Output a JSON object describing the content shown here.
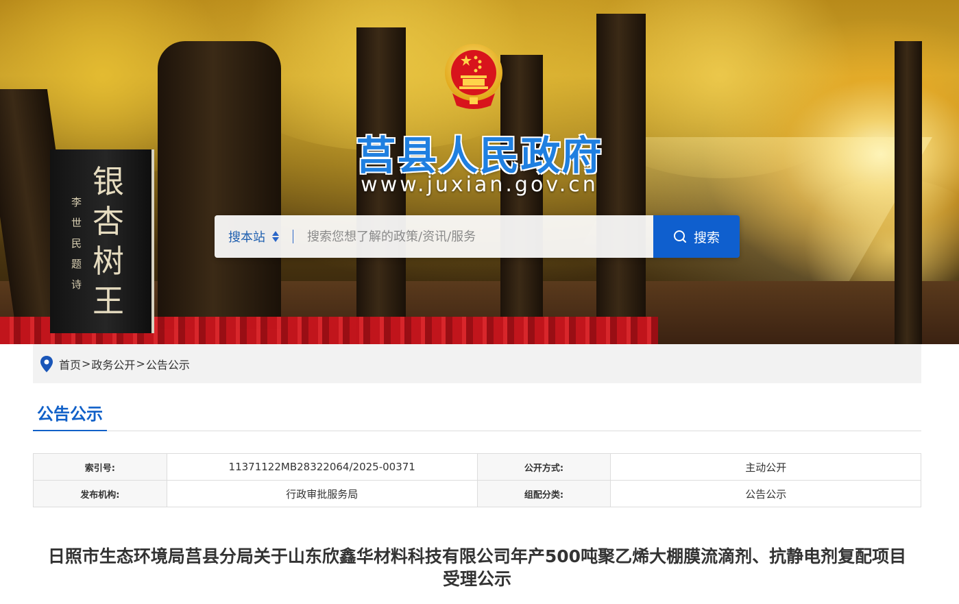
{
  "banner": {
    "site_title": "莒县人民政府",
    "site_url": "www.juxian.gov.cn",
    "stele_text": "银杏树王",
    "stele_small": "李世民题诗"
  },
  "search": {
    "scope_label": "搜本站",
    "placeholder": "搜索您想了解的政策/资讯/服务",
    "button_label": "搜索"
  },
  "breadcrumb": {
    "items": [
      "首页",
      "政务公开",
      "公告公示"
    ],
    "separator": ">"
  },
  "section": {
    "title": "公告公示"
  },
  "meta": {
    "rows": [
      {
        "k1": "索引号:",
        "v1": "11371122MB28322064/2025-00371",
        "k2": "公开方式:",
        "v2": "主动公开"
      },
      {
        "k1": "发布机构:",
        "v1": "行政审批服务局",
        "k2": "组配分类:",
        "v2": "公告公示"
      }
    ]
  },
  "article": {
    "title_line1": "日照市生态环境局莒县分局关于山东欣鑫华材料科技有限公司年产500吨聚乙烯大棚膜流滴剂、抗静电剂复配项目",
    "title_line2": "受理公示"
  },
  "colors": {
    "brand_blue": "#1060c8",
    "search_button": "#0f5fce",
    "breadcrumb_bg": "#f2f2f2"
  }
}
